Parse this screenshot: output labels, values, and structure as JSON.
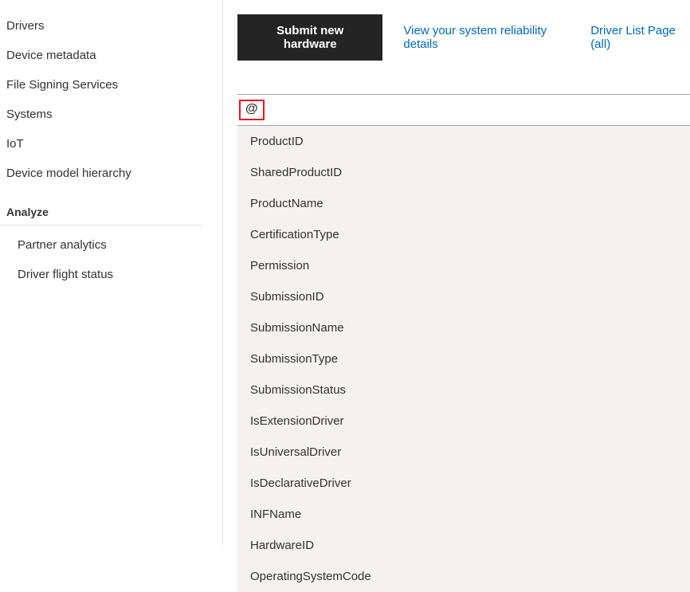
{
  "sidebar": {
    "items": [
      {
        "label": "Drivers"
      },
      {
        "label": "Device metadata"
      },
      {
        "label": "File Signing Services"
      },
      {
        "label": "Systems"
      },
      {
        "label": "IoT"
      },
      {
        "label": "Device model hierarchy"
      }
    ],
    "section_header": "Analyze",
    "subitems": [
      {
        "label": "Partner analytics"
      },
      {
        "label": "Driver flight status"
      }
    ]
  },
  "actions": {
    "submit_label": "Submit new hardware",
    "reliability_link": "View your system reliability details",
    "driver_list_link": "Driver List Page (all)"
  },
  "search": {
    "highlighted_char": "@"
  },
  "dropdown": {
    "items": [
      {
        "label": "ProductID"
      },
      {
        "label": "SharedProductID"
      },
      {
        "label": "ProductName"
      },
      {
        "label": "CertificationType"
      },
      {
        "label": "Permission"
      },
      {
        "label": "SubmissionID"
      },
      {
        "label": "SubmissionName"
      },
      {
        "label": "SubmissionType"
      },
      {
        "label": "SubmissionStatus"
      },
      {
        "label": "IsExtensionDriver"
      },
      {
        "label": "IsUniversalDriver"
      },
      {
        "label": "IsDeclarativeDriver"
      },
      {
        "label": "INFName"
      },
      {
        "label": "HardwareID"
      },
      {
        "label": "OperatingSystemCode"
      }
    ]
  }
}
